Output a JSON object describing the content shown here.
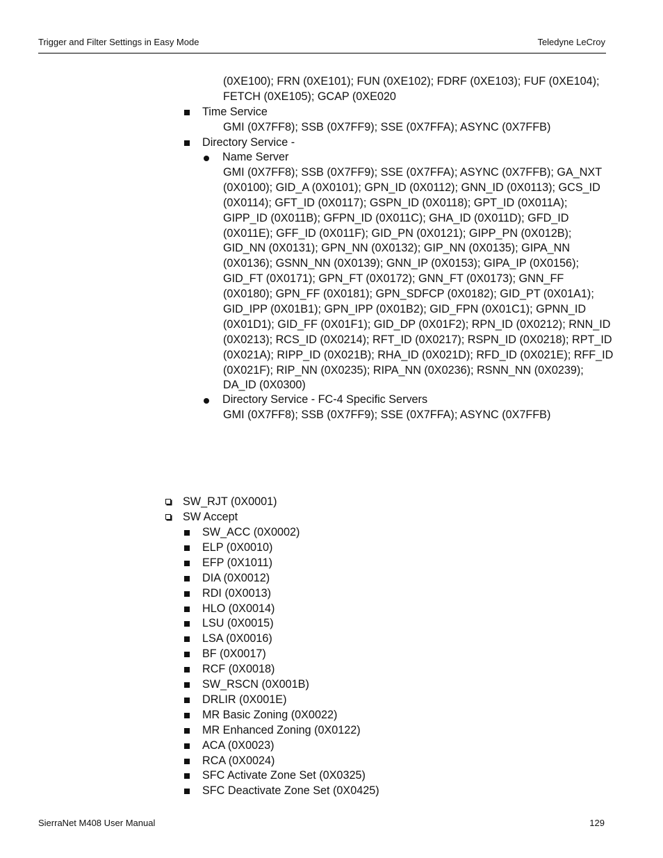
{
  "header": {
    "left": "Trigger and Filter Settings in Easy Mode",
    "right": "Teledyne  LeCroy"
  },
  "footer": {
    "left": "SierraNet M408 User Manual",
    "page_number": "129"
  },
  "top_continuation": [
    "(0XE100); FRN (0XE101); FUN (0XE102); FDRF (0XE103); FUF (0XE104);",
    "FETCH (0XE105); GCAP (0XE020"
  ],
  "time_service": {
    "label": "Time Service",
    "codes": "GMI (0X7FF8); SSB (0X7FF9); SSE (0X7FFA); ASYNC (0X7FFB)"
  },
  "directory_service": {
    "label": "Directory Service -",
    "name_server": {
      "label": "Name Server",
      "lines": [
        "GMI (0X7FF8); SSB (0X7FF9); SSE (0X7FFA); ASYNC (0X7FFB); GA_NXT",
        "(0X0100); GID_A (0X0101); GPN_ID (0X0112); GNN_ID (0X0113); GCS_ID",
        "(0X0114); GFT_ID (0X0117); GSPN_ID (0X0118); GPT_ID (0X011A);",
        "GIPP_ID (0X011B); GFPN_ID (0X011C); GHA_ID (0X011D); GFD_ID",
        "(0X011E); GFF_ID (0X011F); GID_PN (0X0121); GIPP_PN (0X012B);",
        "GID_NN (0X0131); GPN_NN (0X0132); GIP_NN (0X0135); GIPA_NN",
        "(0X0136); GSNN_NN (0X0139); GNN_IP (0X0153); GIPA_IP (0X0156);",
        "GID_FT (0X0171); GPN_FT (0X0172); GNN_FT (0X0173); GNN_FF",
        "(0X0180); GPN_FF (0X0181); GPN_SDFCP (0X0182); GID_PT (0X01A1);",
        "GID_IPP (0X01B1); GPN_IPP (0X01B2); GID_FPN (0X01C1); GPNN_ID",
        "(0X01D1); GID_FF (0X01F1); GID_DP (0X01F2); RPN_ID (0X0212); RNN_ID",
        "(0X0213); RCS_ID (0X0214); RFT_ID (0X0217); RSPN_ID (0X0218); RPT_ID",
        "(0X021A); RIPP_ID (0X021B); RHA_ID (0X021D); RFD_ID (0X021E); RFF_ID",
        "(0X021F); RIP_NN (0X0235); RIPA_NN (0X0236); RSNN_NN (0X0239);",
        "DA_ID (0X0300)"
      ]
    },
    "fc4_servers": {
      "label": "Directory Service - FC-4 Specific Servers",
      "codes": "GMI (0X7FF8); SSB (0X7FF9); SSE (0X7FFA); ASYNC (0X7FFB)"
    }
  },
  "sw_list": {
    "sw_rjt": "SW_RJT (0X0001)",
    "sw_accept": "SW Accept",
    "accept_items": [
      "SW_ACC (0X0002)",
      "ELP (0X0010)",
      "EFP (0X1011)",
      "DIA (0X0012)",
      "RDI (0X0013)",
      "HLO (0X0014)",
      "LSU (0X0015)",
      "LSA (0X0016)",
      "BF (0X0017)",
      "RCF (0X0018)",
      "SW_RSCN (0X001B)",
      "DRLIR (0X001E)",
      "MR Basic Zoning (0X0022)",
      "MR Enhanced Zoning (0X0122)",
      "ACA (0X0023)",
      "RCA (0X0024)",
      "SFC Activate Zone Set (0X0325)",
      "SFC Deactivate Zone Set (0X0425)"
    ]
  }
}
